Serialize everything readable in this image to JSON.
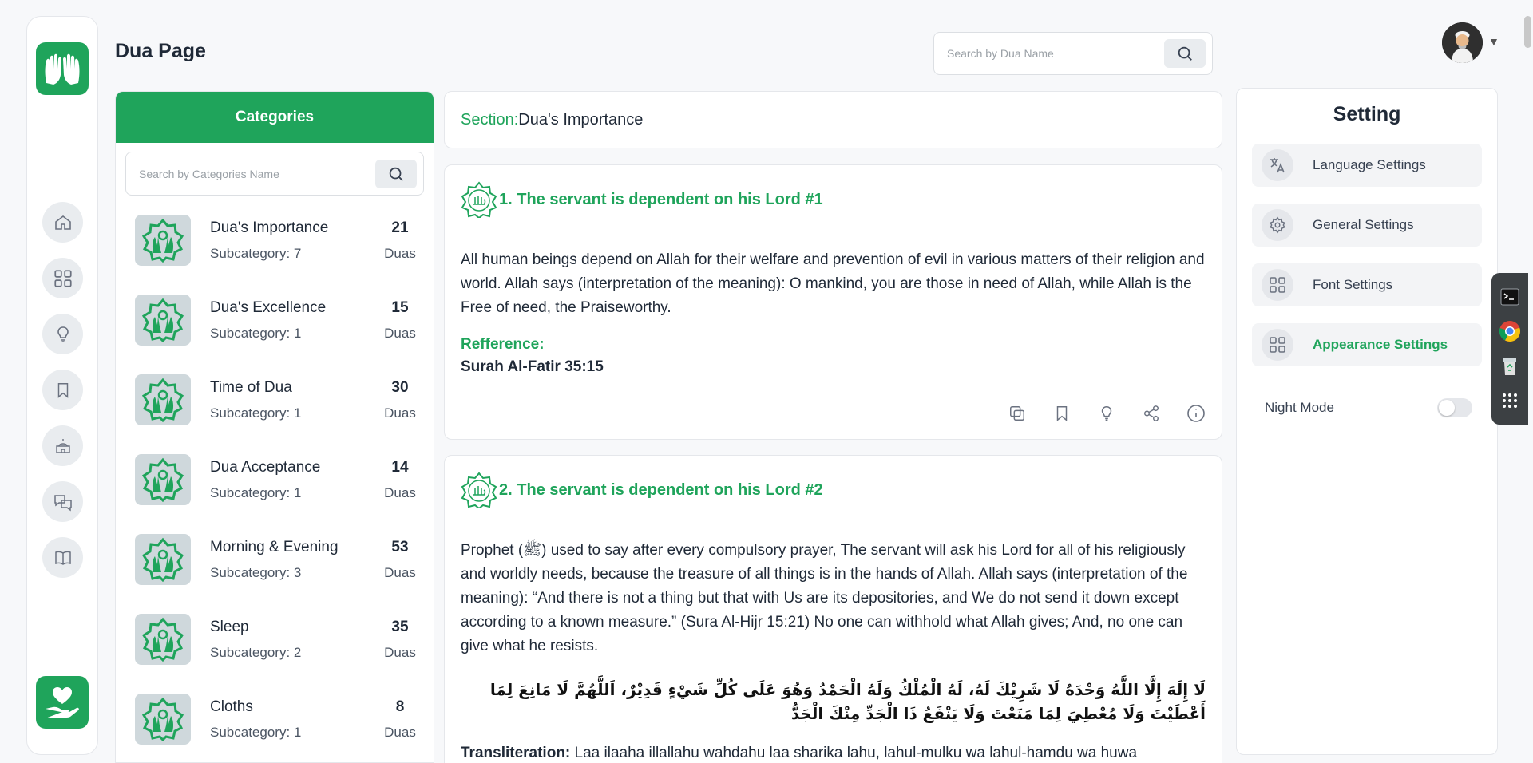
{
  "header": {
    "title": "Dua Page",
    "search_placeholder": "Search by Dua Name"
  },
  "colors": {
    "accent": "#1fa45b",
    "surface": "#ffffff",
    "background": "#f7f8fa"
  },
  "rail": {
    "nav_icons": [
      "home-icon",
      "grid-icon",
      "bulb-icon",
      "bookmark-icon",
      "mosque-icon",
      "chat-icon",
      "book-icon"
    ]
  },
  "categories": {
    "title": "Categories",
    "search_placeholder": "Search by Categories Name",
    "items": [
      {
        "name": "Dua's Importance",
        "sub": "Subcategory: 7",
        "count": "21",
        "unit": "Duas"
      },
      {
        "name": "Dua's Excellence",
        "sub": "Subcategory: 1",
        "count": "15",
        "unit": "Duas"
      },
      {
        "name": "Time of Dua",
        "sub": "Subcategory: 1",
        "count": "30",
        "unit": "Duas"
      },
      {
        "name": "Dua Acceptance",
        "sub": "Subcategory: 1",
        "count": "14",
        "unit": "Duas"
      },
      {
        "name": "Morning & Evening",
        "sub": "Subcategory: 3",
        "count": "53",
        "unit": "Duas"
      },
      {
        "name": "Sleep",
        "sub": "Subcategory: 2",
        "count": "35",
        "unit": "Duas"
      },
      {
        "name": "Cloths",
        "sub": "Subcategory: 1",
        "count": "8",
        "unit": "Duas"
      }
    ]
  },
  "section": {
    "label": "Section:",
    "value": "Dua's Importance"
  },
  "duas": [
    {
      "title": "1. The servant is dependent on his Lord #1",
      "body": "All human beings depend on Allah for their welfare and prevention of evil in various matters of their religion and world. Allah says (interpretation of the meaning): O mankind, you are those in need of Allah, while Allah is the Free of need, the Praiseworthy.",
      "ref_label": "Refference:",
      "ref_value": "Surah Al-Fatir 35:15"
    },
    {
      "title": "2. The servant is dependent on his Lord #2",
      "body": "Prophet (ﷺ) used to say after every compulsory prayer, The servant will ask his Lord for all of his religiously and worldly needs, because the treasure of all things is in the hands of Allah. Allah says (interpretation of the meaning): “And there is not a thing but that with Us are its depositories, and We do not send it down except according to a known measure.” (Sura Al-Hijr 15:21) No one can withhold what Allah gives; And, no one can give what he resists.",
      "arabic": "لَا إِلَهَ إِلَّا اللَّهُ وَحْدَهُ لَا شَرِيْكَ لَهُ، لَهُ الْمُلْكُ وَلَهُ الْحَمْدُ وَهُوَ عَلَى كُلِّ شَيْءٍ قَدِيْرٌ، اَللَّهُمَّ لَا مَانِعَ لِمَا أَعْطَيْتَ وَلَا مُعْطِيَ لِمَا مَنَعْتَ وَلَا يَنْفَعُ ذَا الْجَدِّ مِنْكَ الْجَدُّ",
      "translit_label": "Transliteration:",
      "translit_value": "Laa ilaaha illallahu wahdahu laa sharika lahu, lahul-mulku wa lahul-hamdu wa huwa"
    }
  ],
  "settings": {
    "title": "Setting",
    "items": [
      {
        "label": "Language Settings",
        "icon": "translate-icon",
        "active": false
      },
      {
        "label": "General Settings",
        "icon": "gear-icon",
        "active": false
      },
      {
        "label": "Font Settings",
        "icon": "grid-icon",
        "active": false
      },
      {
        "label": "Appearance Settings",
        "icon": "grid-icon",
        "active": true
      }
    ],
    "night_mode_label": "Night Mode",
    "night_mode_on": false
  }
}
